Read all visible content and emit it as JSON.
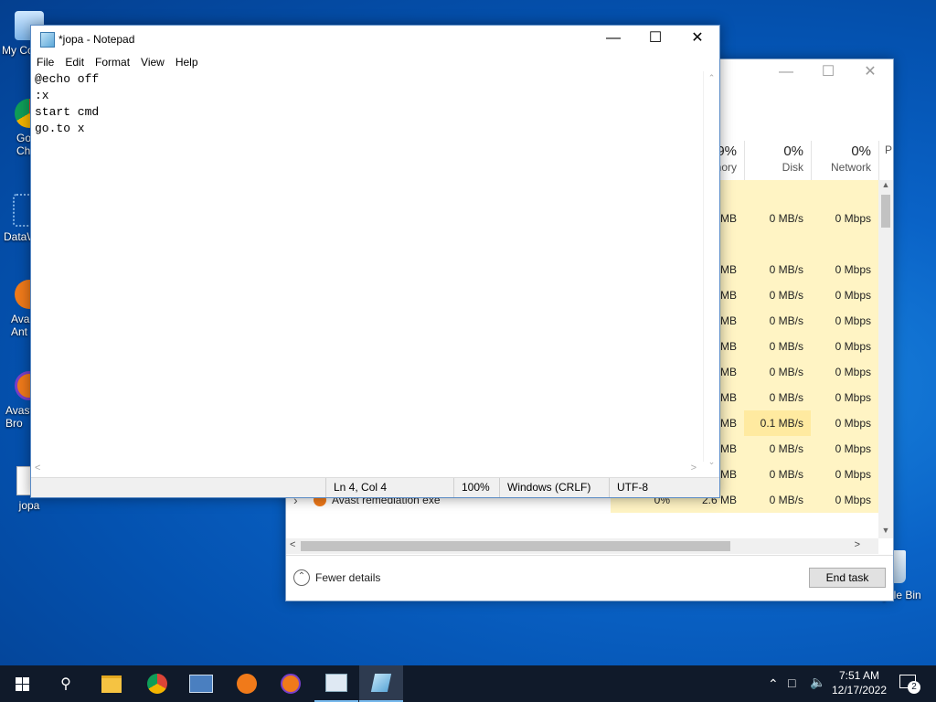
{
  "desktop": {
    "icons": [
      {
        "label": "My Co",
        "icon": "computer-icon"
      },
      {
        "label": "Go\nCh",
        "icon": "chrome-icon"
      },
      {
        "label": "DataW",
        "icon": "datawrapper-icon"
      },
      {
        "label": "Ava\nAnt",
        "icon": "avast-antivirus-icon"
      },
      {
        "label": "Avast\nBro",
        "icon": "avast-browser-icon"
      },
      {
        "label": "jopa",
        "icon": "text-file-icon"
      },
      {
        "label": "Recycle Bin",
        "icon": "recycle-bin-icon"
      }
    ]
  },
  "taskmanager": {
    "columns": [
      {
        "pct": "9%",
        "name": "nory"
      },
      {
        "pct": "0%",
        "name": "Disk"
      },
      {
        "pct": "0%",
        "name": "Network"
      },
      {
        "pct": "",
        "name": "P"
      }
    ],
    "rows": [
      {
        "name": "",
        "cpu": "",
        "mem": "",
        "disk": "",
        "net": ""
      },
      {
        "name": "",
        "cpu": "",
        "mem": "MB",
        "disk": "0 MB/s",
        "net": "0 Mbps"
      },
      {
        "name": "",
        "cpu": "",
        "mem": "",
        "disk": "",
        "net": ""
      },
      {
        "name": "",
        "cpu": "",
        "mem": "MB",
        "disk": "0 MB/s",
        "net": "0 Mbps"
      },
      {
        "name": "",
        "cpu": "",
        "mem": "MB",
        "disk": "0 MB/s",
        "net": "0 Mbps"
      },
      {
        "name": "",
        "cpu": "",
        "mem": "MB",
        "disk": "0 MB/s",
        "net": "0 Mbps"
      },
      {
        "name": "",
        "cpu": "",
        "mem": "MB",
        "disk": "0 MB/s",
        "net": "0 Mbps"
      },
      {
        "name": "",
        "cpu": "",
        "mem": "MB",
        "disk": "0 MB/s",
        "net": "0 Mbps"
      },
      {
        "name": "",
        "cpu": "",
        "mem": "MB",
        "disk": "0 MB/s",
        "net": "0 Mbps"
      },
      {
        "name": "",
        "cpu": "",
        "mem": "MB",
        "disk": "0.1 MB/s",
        "net": "0 Mbps"
      },
      {
        "name": "",
        "cpu": "",
        "mem": "MB",
        "disk": "0 MB/s",
        "net": "0 Mbps"
      },
      {
        "name": "",
        "cpu": "",
        "mem": "MB",
        "disk": "0 MB/s",
        "net": "0 Mbps"
      },
      {
        "name": "Avast remediation exe",
        "cpu": "0%",
        "mem": "2.6 MB",
        "disk": "0 MB/s",
        "net": "0 Mbps"
      }
    ],
    "fewer_details": "Fewer details",
    "end_task": "End task"
  },
  "notepad": {
    "title": "*jopa - Notepad",
    "menu": [
      "File",
      "Edit",
      "Format",
      "View",
      "Help"
    ],
    "content": "@echo off\n:x\nstart cmd\ngo.to x",
    "status": {
      "position": "Ln 4, Col 4",
      "zoom": "100%",
      "line_ending": "Windows (CRLF)",
      "encoding": "UTF-8"
    }
  },
  "taskbar": {
    "apps": [
      "start-icon",
      "search-icon",
      "file-explorer-icon",
      "chrome-icon",
      "network-app-icon",
      "avast-icon",
      "avast-browser-icon",
      "task-manager-icon",
      "notepad-icon"
    ],
    "time": "7:51 AM",
    "date": "12/17/2022",
    "notification_count": "2"
  }
}
